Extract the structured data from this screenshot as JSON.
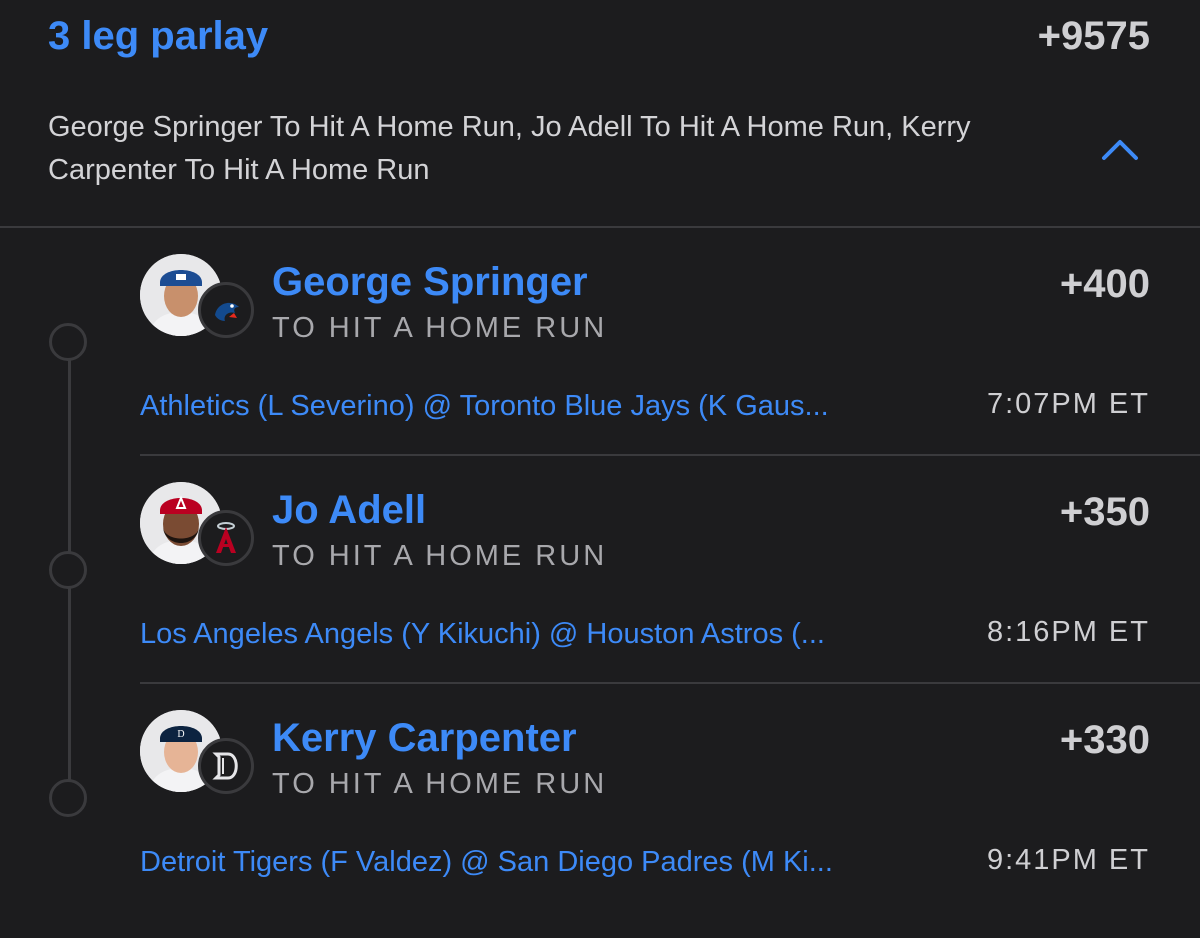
{
  "parlay": {
    "title": "3 leg parlay",
    "odds": "+9575",
    "summary": "George Springer To Hit A Home Run, Jo Adell To Hit A Home Run, Kerry Carpenter To Hit A Home Run",
    "collapse_icon": "chevron-up-icon"
  },
  "legs": [
    {
      "player": "George Springer",
      "market": "TO HIT A HOME RUN",
      "odds": "+400",
      "game": "Athletics (L Severino) @ Toronto Blue Jays (K Gaus...",
      "time": "7:07PM ET",
      "team_icon": "blue-jays-logo-icon",
      "team_color": "#134a8e",
      "cap_color": "#1d4d93"
    },
    {
      "player": "Jo Adell",
      "market": "TO HIT A HOME RUN",
      "odds": "+350",
      "game": "Los Angeles Angels (Y Kikuchi) @ Houston Astros (...",
      "time": "8:16PM ET",
      "team_icon": "angels-logo-icon",
      "team_color": "#ba0021",
      "cap_color": "#ba0021"
    },
    {
      "player": "Kerry Carpenter",
      "market": "TO HIT A HOME RUN",
      "odds": "+330",
      "game": "Detroit Tigers (F Valdez) @ San Diego Padres (M Ki...",
      "time": "9:41PM ET",
      "team_icon": "tigers-logo-icon",
      "team_color": "#0c2340",
      "cap_color": "#0c2340"
    }
  ]
}
